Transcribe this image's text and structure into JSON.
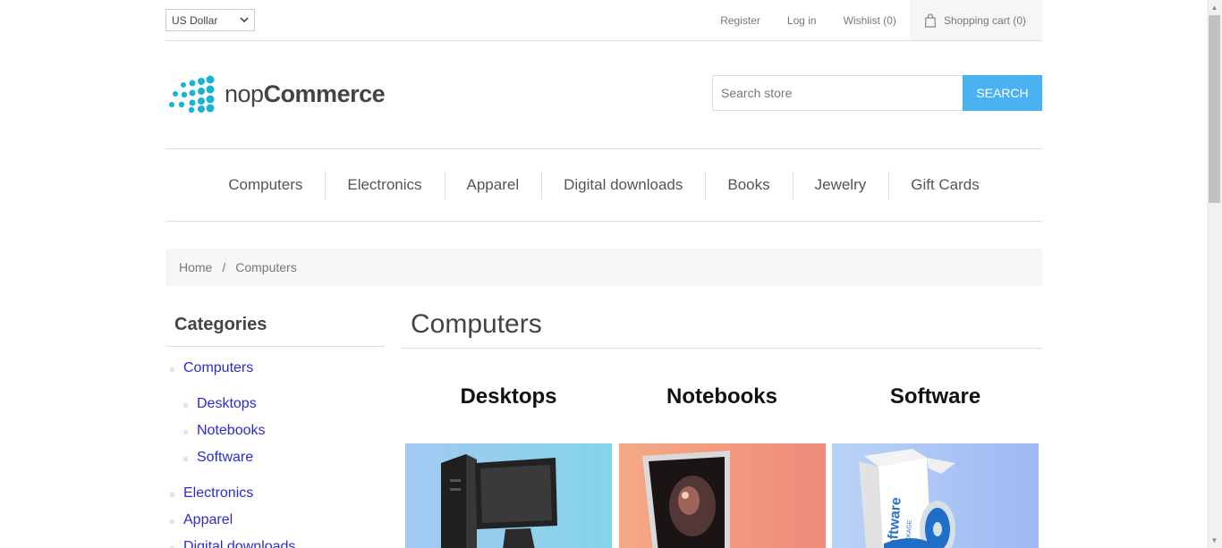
{
  "header": {
    "currency": "US Dollar",
    "links": {
      "register": "Register",
      "login": "Log in",
      "wishlist": "Wishlist (0)",
      "cart": "Shopping cart (0)"
    }
  },
  "logo": {
    "text_light": "nop",
    "text_bold": "Commerce"
  },
  "search": {
    "placeholder": "Search store",
    "button": "SEARCH"
  },
  "menu": [
    "Computers",
    "Electronics",
    "Apparel",
    "Digital downloads",
    "Books",
    "Jewelry",
    "Gift Cards"
  ],
  "breadcrumb": {
    "home": "Home",
    "separator": "/",
    "current": "Computers"
  },
  "sidebar": {
    "title": "Categories",
    "items": [
      {
        "label": "Computers"
      },
      {
        "label": "Desktops"
      },
      {
        "label": "Notebooks"
      },
      {
        "label": "Software"
      },
      {
        "label": "Electronics"
      },
      {
        "label": "Apparel"
      },
      {
        "label": "Digital downloads"
      }
    ]
  },
  "main": {
    "title": "Computers",
    "subcategories": [
      {
        "title": "Desktops"
      },
      {
        "title": "Notebooks"
      },
      {
        "title": "Software"
      }
    ]
  },
  "picture_text": {
    "software_box": "Software",
    "software_box_sub": "PACKAGE"
  },
  "colors": {
    "accent": "#4ab2f1",
    "link": "#2b2bd0",
    "logo": "#19b3d6"
  }
}
